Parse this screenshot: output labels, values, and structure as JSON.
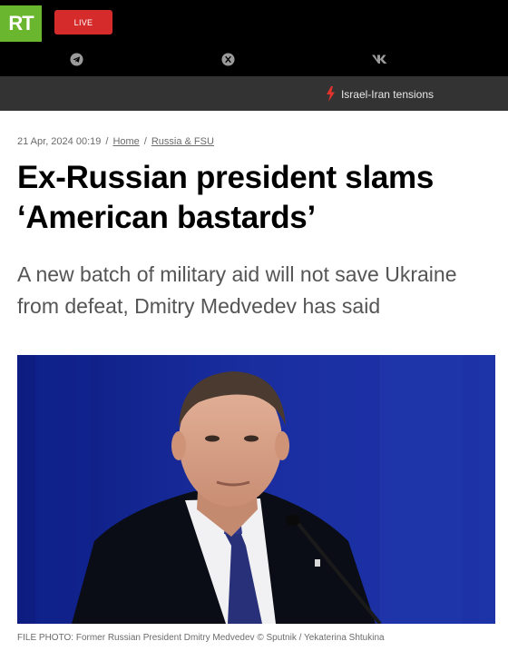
{
  "header": {
    "logo_text": "RT",
    "live_label": "LIVE",
    "socials": [
      "telegram-icon",
      "x-icon",
      "vk-icon"
    ],
    "trending_label": "Israel-Iran tensions",
    "colors": {
      "logo": "#6ab72f",
      "live": "#d62b2b",
      "bolt": "#e2332c"
    }
  },
  "article": {
    "date": "21 Apr, 2024 00:19",
    "separator": "/",
    "breadcrumbs": [
      "Home",
      "Russia & FSU"
    ],
    "title": "Ex-Russian president slams ‘American bastards’",
    "subtitle": "A new batch of military aid will not save Ukraine from defeat, Dmitry Medvedev has said",
    "photo_caption": "FILE PHOTO: Former Russian President Dmitry Medvedev ©  Sputnik / Yekaterina Shtukina"
  }
}
